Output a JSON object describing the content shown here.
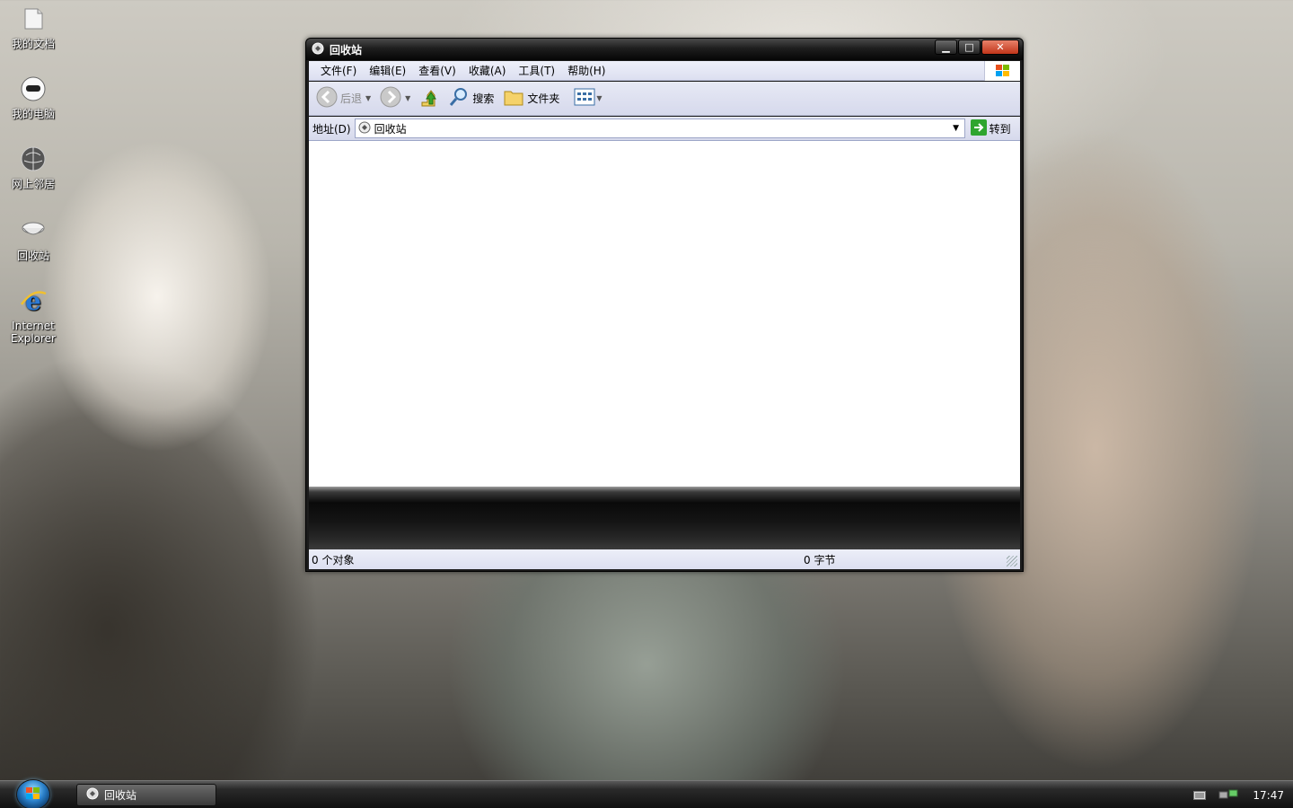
{
  "desktop": {
    "icons": [
      {
        "label": "我的文档"
      },
      {
        "label": "我的电脑"
      },
      {
        "label": "网上邻居"
      },
      {
        "label": "回收站"
      },
      {
        "label": "Internet Explorer"
      }
    ]
  },
  "window": {
    "title": "回收站",
    "menu": [
      "文件(F)",
      "编辑(E)",
      "查看(V)",
      "收藏(A)",
      "工具(T)",
      "帮助(H)"
    ],
    "toolbar": {
      "back": "后退",
      "search": "搜索",
      "folders": "文件夹"
    },
    "address": {
      "label": "地址(D)",
      "value": "回收站",
      "go": "转到"
    },
    "status": {
      "objects": "0 个对象",
      "size": "0 字节"
    }
  },
  "taskbar": {
    "task": "回收站",
    "clock": "17:47"
  },
  "colors": {
    "menu_bg": "#dcdff0",
    "close_btn": "#c1351a",
    "titlebar": "#1e1e1e"
  }
}
